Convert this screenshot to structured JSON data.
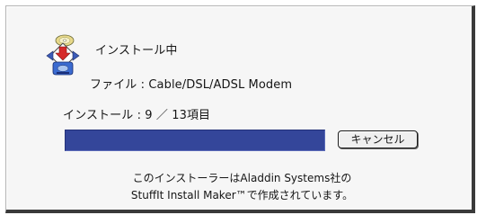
{
  "dialog": {
    "status_title": "インストール中",
    "file_label": "ファイル : Cable/DSL/ADSL Modem",
    "progress_text": "インストール : 9 ／ 13項目",
    "progress": {
      "current": 9,
      "total": 13
    },
    "cancel_label": "キャンセル",
    "credit_line1": "このインストーラーはAladdin Systems社の",
    "credit_line2": "StuffIt Install Maker™で作成されています。"
  },
  "icons": {
    "installer": "installer-disc-arrows-icon"
  },
  "colors": {
    "progress_fill": "#34469a",
    "dialog_background": "#f6f6f6"
  }
}
